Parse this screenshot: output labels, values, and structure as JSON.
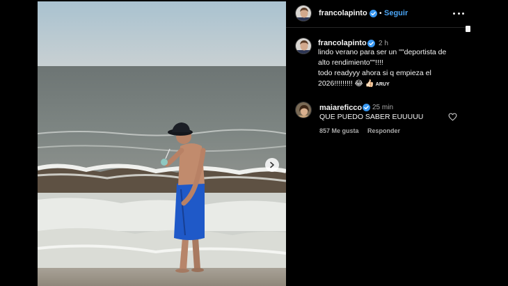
{
  "colors": {
    "background": "#000000",
    "follow": "#4aa5f5",
    "verified": "#3897f0",
    "secondary_text": "#a8a8a8"
  },
  "photo": {
    "has_next": true,
    "next_icon": "chevron-right-icon"
  },
  "header": {
    "username": "francolapinto",
    "separator": "•",
    "follow_label": "Seguir",
    "more_icon": "more-options-icon"
  },
  "post": {
    "username": "francolapinto",
    "time": "2 h",
    "caption_lines": [
      "lindo verano para ser un \"\"deportista de",
      "alto rendimiento\"\"!!!!",
      "todo readyyy ahora si q empieza el",
      "2026!!!!!!!!! 😂 👍🏻"
    ],
    "caption_tag": "ARUY"
  },
  "comment": {
    "username": "maiareficco",
    "time": "25 min",
    "text": "QUE PUEDO SABER EUUUUU",
    "likes": "857 Me gusta",
    "reply_label": "Responder",
    "like_icon": "heart-icon"
  }
}
